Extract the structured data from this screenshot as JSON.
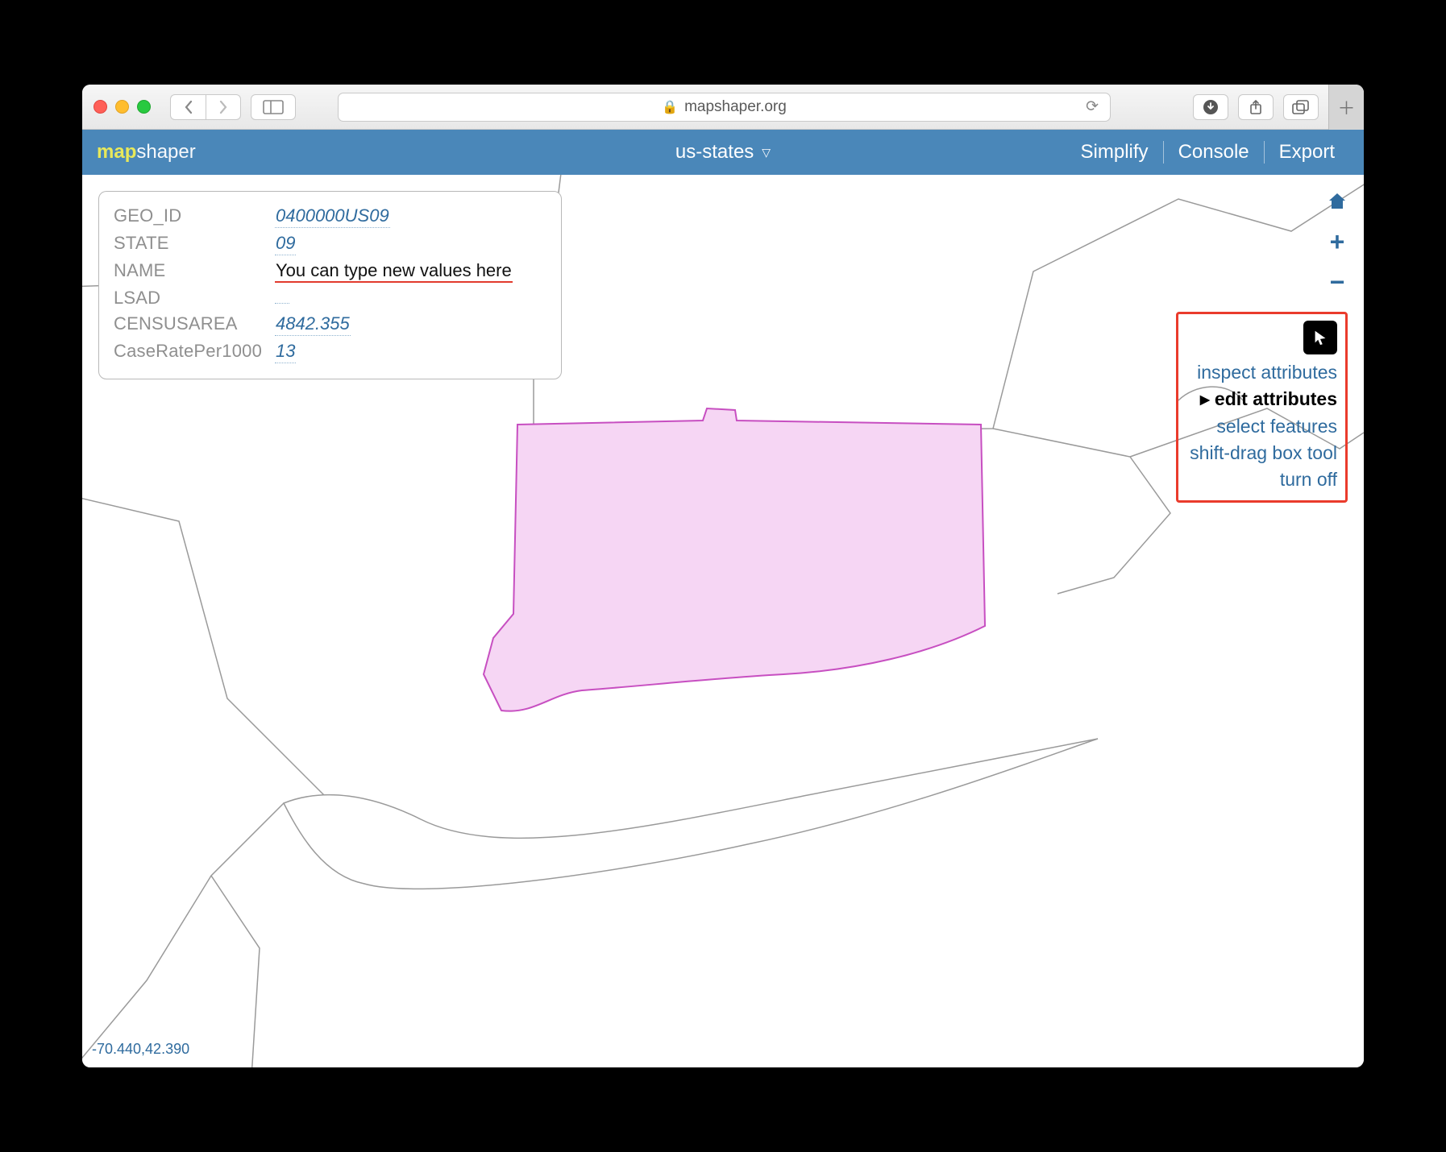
{
  "browser": {
    "url_display": "mapshaper.org"
  },
  "app": {
    "logo_bold": "map",
    "logo_rest": "shaper",
    "layer_name": "us-states",
    "menu": {
      "simplify": "Simplify",
      "console": "Console",
      "export": "Export"
    }
  },
  "attributes": {
    "rows": [
      {
        "key": "GEO_ID",
        "value": "0400000US09"
      },
      {
        "key": "STATE",
        "value": "09"
      },
      {
        "key": "NAME",
        "value": "You can type new values here",
        "editing": true
      },
      {
        "key": "LSAD",
        "value": ""
      },
      {
        "key": "CENSUSAREA",
        "value": "4842.355"
      },
      {
        "key": "CaseRatePer1000",
        "value": "13"
      }
    ]
  },
  "tool_menu": {
    "inspect": "inspect attributes",
    "edit": "edit attributes",
    "select": "select features",
    "box": "shift-drag box tool",
    "off": "turn off"
  },
  "coords": "-70.440,42.390"
}
